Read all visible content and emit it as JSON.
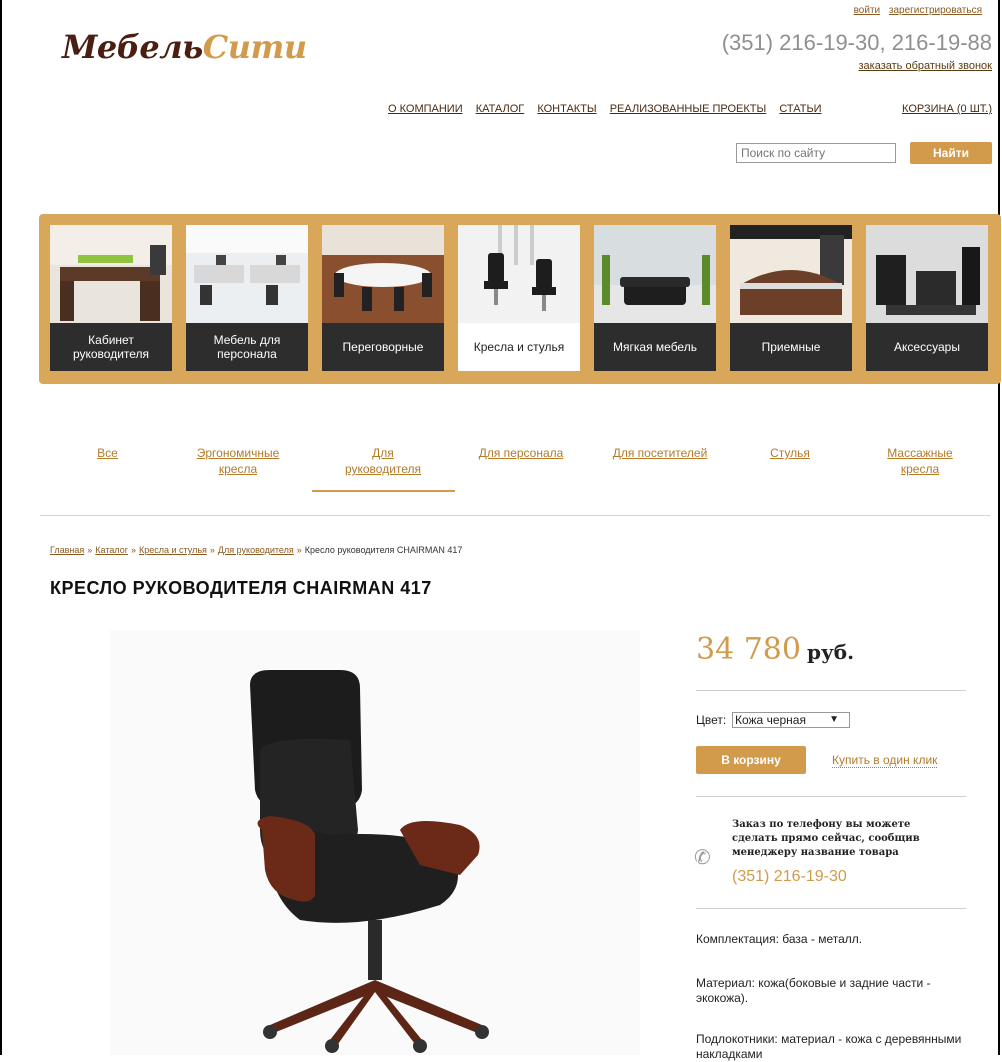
{
  "header": {
    "logo_part1": "Мебель",
    "logo_part2": "Сити",
    "login": "войти",
    "register": "зарегистрироваться",
    "phones": "(351) 216-19-30, 216-19-88",
    "callback": "заказать обратный звонок"
  },
  "nav": {
    "items": [
      "О КОМПАНИИ",
      "КАТАЛОГ",
      "КОНТАКТЫ",
      "РЕАЛИЗОВАННЫЕ ПРОЕКТЫ",
      "СТАТЬИ"
    ],
    "cart": "КОРЗИНА (0 ШТ.)"
  },
  "search": {
    "placeholder": "Поиск по сайту",
    "button": "Найти"
  },
  "categories": [
    {
      "label": "Кабинет руководителя"
    },
    {
      "label": "Мебель для персонала"
    },
    {
      "label": "Переговорные"
    },
    {
      "label": "Кресла и стулья",
      "active": true
    },
    {
      "label": "Мягкая мебель"
    },
    {
      "label": "Приемные"
    },
    {
      "label": "Аксессуары"
    }
  ],
  "subnav": [
    "Все",
    "Эргономичные кресла",
    "Для руководителя",
    "Для персонала",
    "Для посетителей",
    "Стулья",
    "Массажные кресла"
  ],
  "breadcrumb": {
    "items": [
      "Главная",
      "Каталог",
      "Кресла и стулья",
      "Для руководителя"
    ],
    "current": "Кресло руководителя CHAIRMAN 417",
    "separator": "»"
  },
  "product": {
    "title": "КРЕСЛО РУКОВОДИТЕЛЯ CHAIRMAN 417",
    "price": "34 780",
    "currency": "руб.",
    "color_label": "Цвет:",
    "color_value": "Кожа черная",
    "cart_button": "В корзину",
    "one_click": "Купить в один клик",
    "order_text": "Заказ по телефону вы можете сделать прямо сейчас, сообщив менеджеру название товара",
    "order_phone": "(351) 216-19-30",
    "spec1": "Комплектация: база - металл.",
    "spec2": "Материал: кожа(боковые и задние части - экокожа).",
    "spec3": "Подлокотники: материал - кожа с деревянными накладками"
  },
  "colors": {
    "accent": "#d29a4b",
    "brand_dark": "#4a1f12",
    "category_bar": "#d9a75a",
    "label_dark": "#2d2d2d"
  }
}
